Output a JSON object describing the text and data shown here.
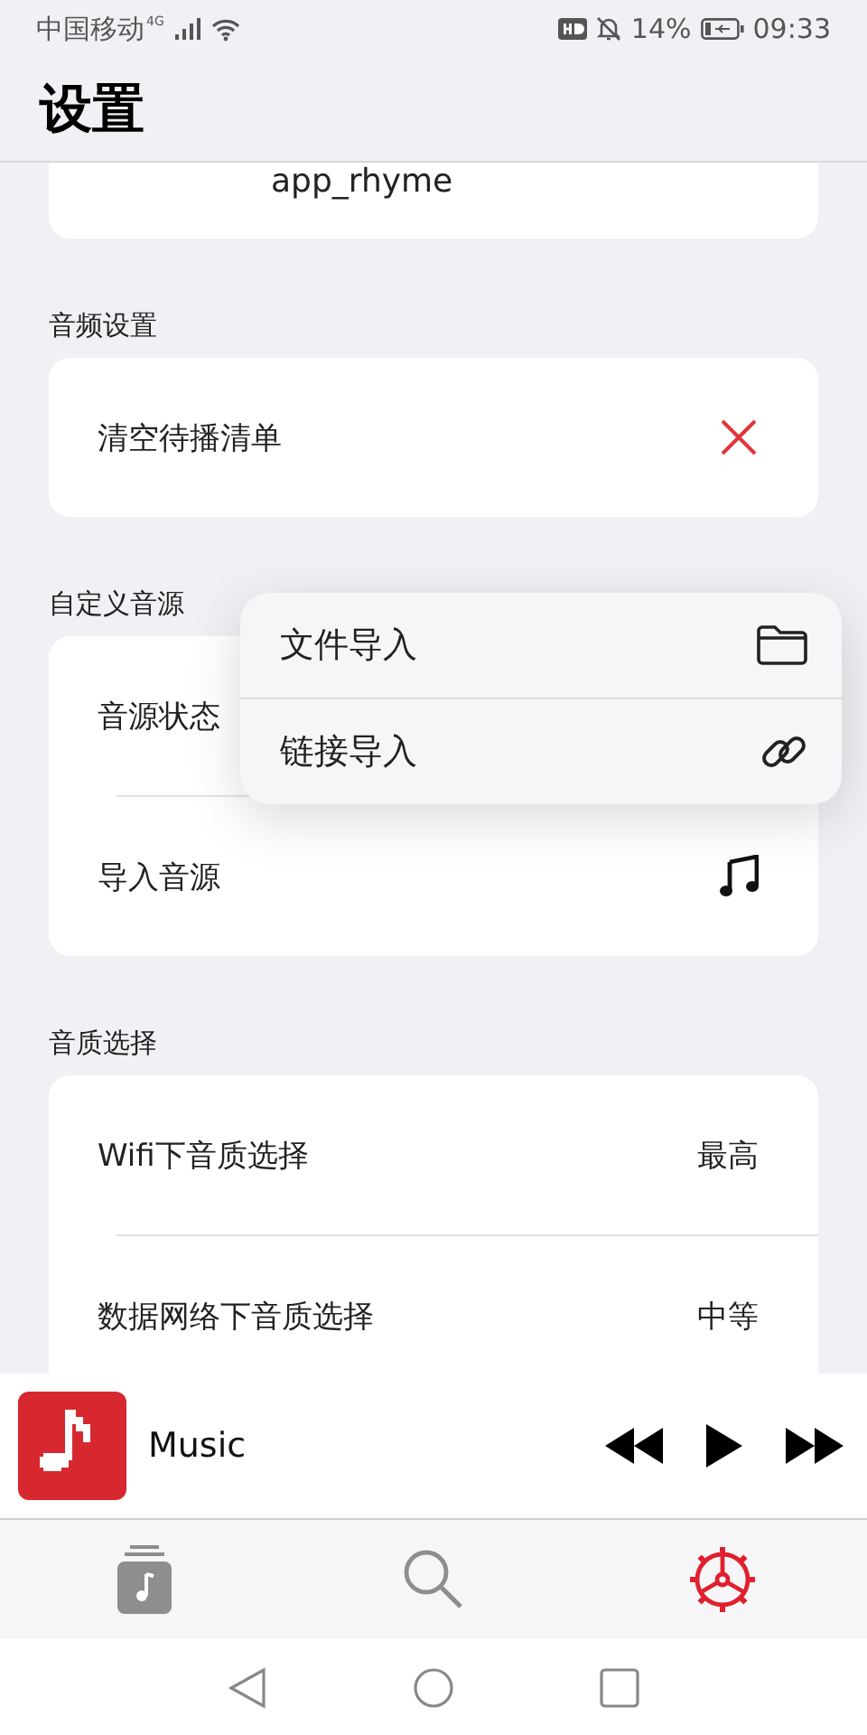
{
  "status_bar": {
    "carrier": "中国移动",
    "network": "4G",
    "battery": "14%",
    "time": "09:33"
  },
  "header": {
    "title": "设置"
  },
  "partial_card": {
    "value": "app_rhyme"
  },
  "sections": [
    {
      "title": "音频设置",
      "rows": [
        {
          "label": "清空待播清单",
          "kind": "clear"
        }
      ]
    },
    {
      "title": "自定义音源",
      "rows": [
        {
          "label": "音源状态",
          "kind": "plain"
        },
        {
          "label": "导入音源",
          "kind": "import"
        }
      ]
    },
    {
      "title": "音质选择",
      "rows": [
        {
          "label": "Wifi下音质选择",
          "kind": "value",
          "value": "最高"
        },
        {
          "label": "数据网络下音质选择",
          "kind": "value",
          "value": "中等"
        }
      ]
    }
  ],
  "popup_menu": [
    {
      "label": "文件导入",
      "kind": "folder"
    },
    {
      "label": "链接导入",
      "kind": "link"
    }
  ],
  "player": {
    "title": "Music"
  },
  "tabs": [
    {
      "kind": "library",
      "selected": false
    },
    {
      "kind": "search",
      "selected": false
    },
    {
      "kind": "settings",
      "selected": true
    }
  ]
}
